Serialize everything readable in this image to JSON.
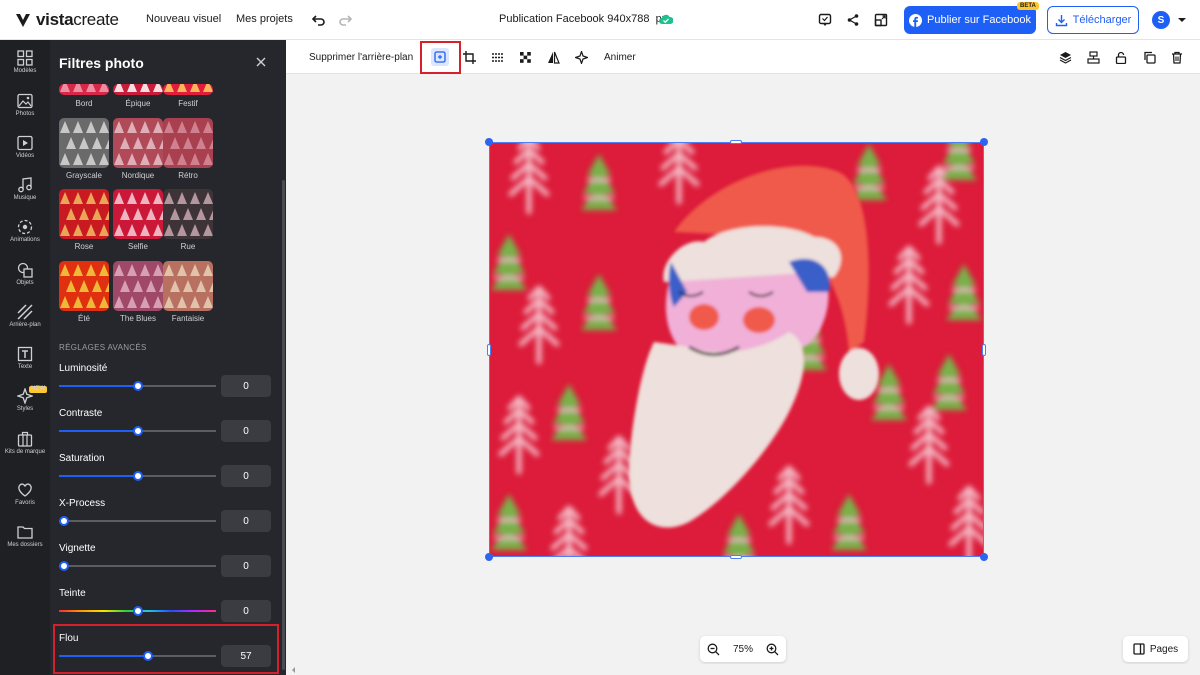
{
  "topbar": {
    "logo": {
      "bold": "vista",
      "light": "create"
    },
    "nav": [
      "Nouveau visuel",
      "Mes projets"
    ],
    "document_title": "Publication Facebook 940x788",
    "document_unit": "px",
    "publish_label": "Publier sur Facebook",
    "beta_badge": "BETA",
    "download_label": "Télécharger",
    "avatar_initial": "S"
  },
  "rail": [
    {
      "label": "Modèles",
      "icon": "templates-icon"
    },
    {
      "label": "Photos",
      "icon": "photos-icon"
    },
    {
      "label": "Vidéos",
      "icon": "videos-icon"
    },
    {
      "label": "Musique",
      "icon": "music-icon"
    },
    {
      "label": "Animations",
      "icon": "animations-icon"
    },
    {
      "label": "Objets",
      "icon": "objects-icon"
    },
    {
      "label": "Arrière-plan",
      "icon": "background-icon"
    },
    {
      "label": "Texte",
      "icon": "text-icon"
    },
    {
      "label": "Styles",
      "icon": "styles-icon",
      "badge": "NEW"
    },
    {
      "label": "Kits de marque",
      "icon": "brand-kit-icon"
    },
    {
      "label": "Favoris",
      "icon": "heart-icon"
    },
    {
      "label": "Mes dossiers",
      "icon": "folder-icon"
    }
  ],
  "panel": {
    "title": "Filtres photo",
    "filters": [
      {
        "label": "Bord",
        "bg": "#d8284a",
        "tree": "#f0a0b0"
      },
      {
        "label": "Épique",
        "bg": "#c81d3a",
        "tree": "#ffffff"
      },
      {
        "label": "Festif",
        "bg": "#e01e3c",
        "tree": "#ffd060"
      },
      {
        "label": "Grayscale",
        "bg": "#6a6a6a",
        "tree": "#d8d8d8"
      },
      {
        "label": "Nordique",
        "bg": "#b04a58",
        "tree": "#e8c0c8"
      },
      {
        "label": "Rétro",
        "bg": "#a84050",
        "tree": "#d88c9a"
      },
      {
        "label": "Rose",
        "bg": "#c81a20",
        "tree": "#f0c060"
      },
      {
        "label": "Selfie",
        "bg": "#cc1838",
        "tree": "#f4d0d8"
      },
      {
        "label": "Rue",
        "bg": "#3e3438",
        "tree": "#c8a8b0"
      },
      {
        "label": "Été",
        "bg": "#e03010",
        "tree": "#f0d040"
      },
      {
        "label": "The Blues",
        "bg": "#a04868",
        "tree": "#e0b0c0"
      },
      {
        "label": "Fantaisie",
        "bg": "#b87060",
        "tree": "#e8d0b8"
      }
    ],
    "advanced_heading": "RÉGLAGES AVANCÉS",
    "sliders": [
      {
        "label": "Luminosité",
        "value": "0",
        "level": 0.5,
        "track": "normal"
      },
      {
        "label": "Contraste",
        "value": "0",
        "level": 0.5,
        "track": "normal"
      },
      {
        "label": "Saturation",
        "value": "0",
        "level": 0.5,
        "track": "normal"
      },
      {
        "label": "X-Process",
        "value": "0",
        "level": 0.0,
        "track": "normal"
      },
      {
        "label": "Vignette",
        "value": "0",
        "level": 0.0,
        "track": "normal"
      },
      {
        "label": "Teinte",
        "value": "0",
        "level": 0.5,
        "track": "rainbow"
      },
      {
        "label": "Flou",
        "value": "57",
        "level": 0.57,
        "track": "normal"
      }
    ]
  },
  "toolbar": {
    "remove_bg_label": "Supprimer l'arrière-plan",
    "animate_label": "Animer"
  },
  "zoom": {
    "value": "75%"
  },
  "pages_label": "Pages",
  "colors": {
    "accent": "#1e5ff5",
    "highlight": "#d6202b",
    "canvas_bg": "#dc1c3a"
  }
}
